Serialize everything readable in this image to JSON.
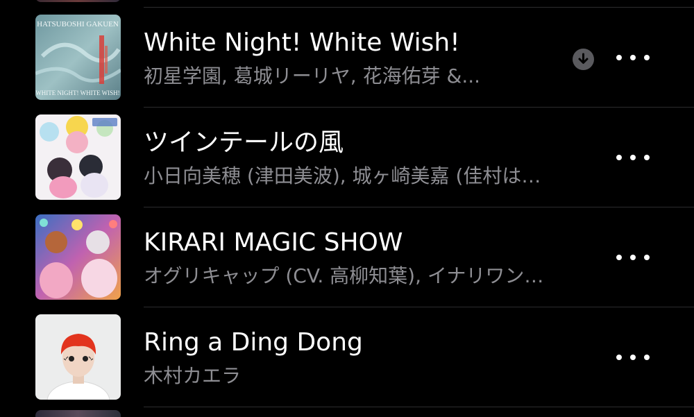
{
  "songs": [
    {
      "title": "White Night! White Wish!",
      "artist": "初星学園, 葛城リーリヤ, 花海佑芽 &...",
      "artwork": "album-cover-white-night",
      "artwork_text_top": "HATSUBOSHI GAKUEN",
      "artwork_text_bottom": "WHITE NIGHT! WHITE WISH!",
      "downloaded_icon": "download-arrow-icon",
      "more_icon": "ellipsis-icon"
    },
    {
      "title": "ツインテールの風",
      "artist": "小日向美穂 (津田美波), 城ヶ崎美嘉 (佳村は…",
      "artwork": "album-cover-twintail",
      "more_icon": "ellipsis-icon"
    },
    {
      "title": "KIRARI MAGIC SHOW",
      "artist": "オグリキャップ (CV. 高柳知葉), イナリワン…",
      "artwork": "album-cover-kirari",
      "more_icon": "ellipsis-icon"
    },
    {
      "title": "Ring a Ding Dong",
      "artist": "木村カエラ",
      "artwork": "album-cover-ring-a-ding-dong",
      "more_icon": "ellipsis-icon"
    }
  ],
  "colors": {
    "background": "#000000",
    "title": "#ffffff",
    "subtitle": "#8e8e93",
    "separator": "#2c2c2e",
    "download_badge": "#5a5a5e"
  }
}
